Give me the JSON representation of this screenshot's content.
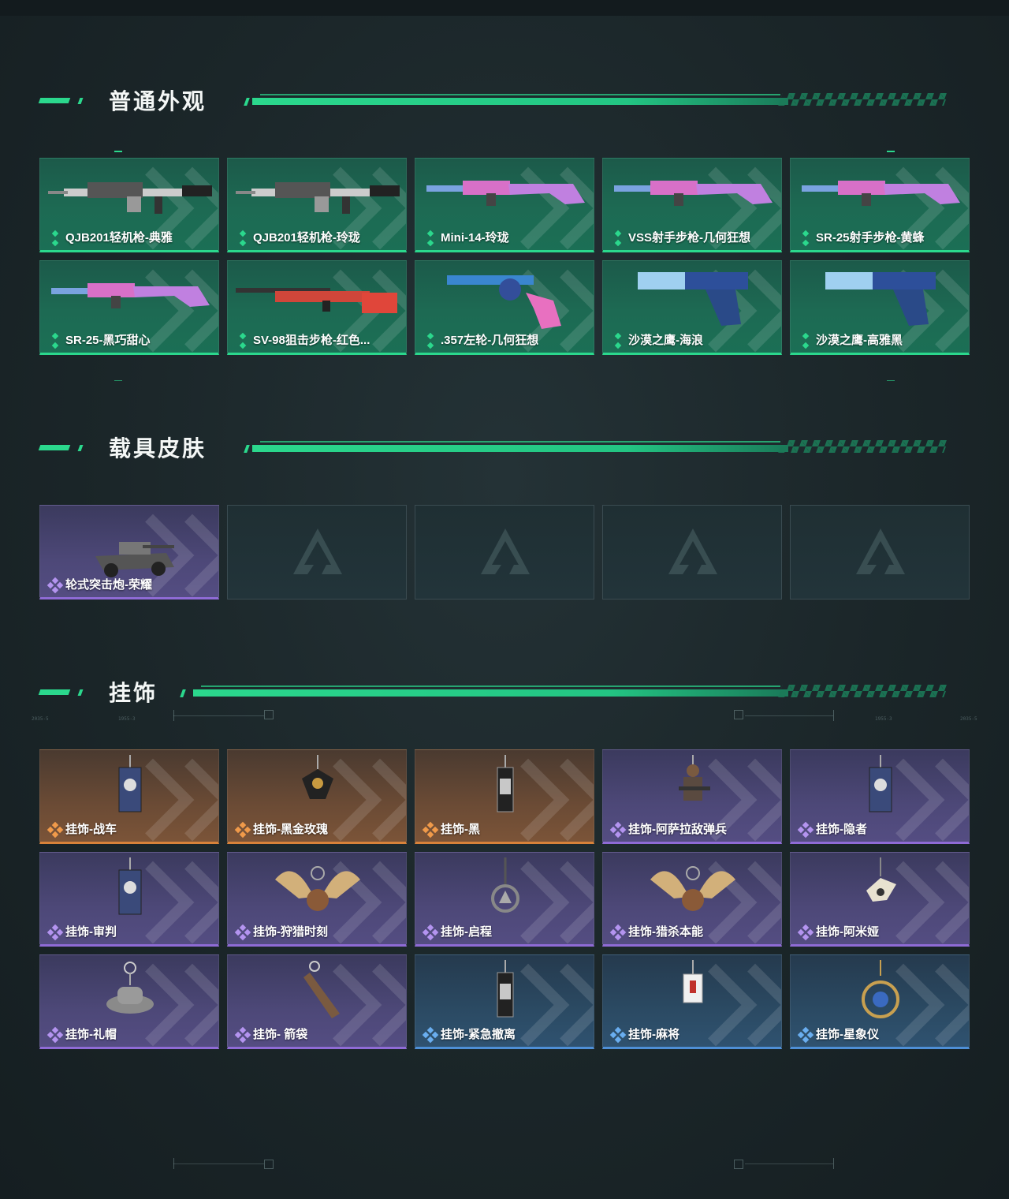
{
  "sections": {
    "skins": {
      "title": "普通外观",
      "items": [
        {
          "label": "QJB201轻机枪-典雅",
          "rarity": "green",
          "icon": "machine-gun-icon"
        },
        {
          "label": "QJB201轻机枪-玲珑",
          "rarity": "green",
          "icon": "machine-gun-icon"
        },
        {
          "label": "Mini-14-玲珑",
          "rarity": "green",
          "icon": "rifle-icon"
        },
        {
          "label": "VSS射手步枪-几何狂想",
          "rarity": "green",
          "icon": "rifle-icon"
        },
        {
          "label": "SR-25射手步枪-黄蜂",
          "rarity": "green",
          "icon": "rifle-icon"
        },
        {
          "label": "SR-25-黑巧甜心",
          "rarity": "green",
          "icon": "rifle-icon"
        },
        {
          "label": "SV-98狙击步枪-红色...",
          "rarity": "green",
          "icon": "sniper-rifle-icon"
        },
        {
          "label": ".357左轮-几何狂想",
          "rarity": "green",
          "icon": "revolver-icon"
        },
        {
          "label": "沙漠之鹰-海浪",
          "rarity": "green",
          "icon": "pistol-icon"
        },
        {
          "label": "沙漠之鹰-高雅黑",
          "rarity": "green",
          "icon": "pistol-icon"
        }
      ]
    },
    "vehicles": {
      "title": "载具皮肤",
      "items": [
        {
          "label": "轮式突击炮-荣耀",
          "rarity": "purple",
          "icon": "armored-vehicle-icon"
        }
      ]
    },
    "charms": {
      "title": "挂饰",
      "items": [
        {
          "label": "挂饰-战车",
          "rarity": "orange",
          "icon": "card-charm-icon"
        },
        {
          "label": "挂饰-黑金玫瑰",
          "rarity": "orange",
          "icon": "rose-charm-icon"
        },
        {
          "label": "挂饰-黑",
          "rarity": "orange",
          "icon": "tag-charm-icon"
        },
        {
          "label": "挂饰-阿萨拉敌弹兵",
          "rarity": "purple",
          "icon": "soldier-charm-icon"
        },
        {
          "label": "挂饰-隐者",
          "rarity": "purple",
          "icon": "card-charm-icon"
        },
        {
          "label": "挂饰-审判",
          "rarity": "purple",
          "icon": "card-charm-icon"
        },
        {
          "label": "挂饰-狩猎时刻",
          "rarity": "purple",
          "icon": "antler-charm-icon"
        },
        {
          "label": "挂饰-启程",
          "rarity": "purple",
          "icon": "ring-charm-icon"
        },
        {
          "label": "挂饰-猎杀本能",
          "rarity": "purple",
          "icon": "antler-charm-icon"
        },
        {
          "label": "挂饰-阿米娅",
          "rarity": "purple",
          "icon": "bird-charm-icon"
        },
        {
          "label": "挂饰-礼帽",
          "rarity": "purple",
          "icon": "hat-charm-icon"
        },
        {
          "label": "挂饰- 箭袋",
          "rarity": "purple",
          "icon": "quiver-charm-icon"
        },
        {
          "label": "挂饰-紧急撤离",
          "rarity": "blue",
          "icon": "tag-charm-icon"
        },
        {
          "label": "挂饰-麻将",
          "rarity": "blue",
          "icon": "mahjong-charm-icon"
        },
        {
          "label": "挂饰-星象仪",
          "rarity": "blue",
          "icon": "astrolabe-charm-icon"
        }
      ]
    }
  },
  "colors": {
    "accent": "#2bd88d",
    "green_rarity": "#2bd88d",
    "purple_rarity": "#8f6bd6",
    "orange_rarity": "#d8823a",
    "blue_rarity": "#4e8fd6"
  },
  "decor_text": [
    "2035-5",
    "1955-3",
    "1955-3",
    "2035-5"
  ]
}
